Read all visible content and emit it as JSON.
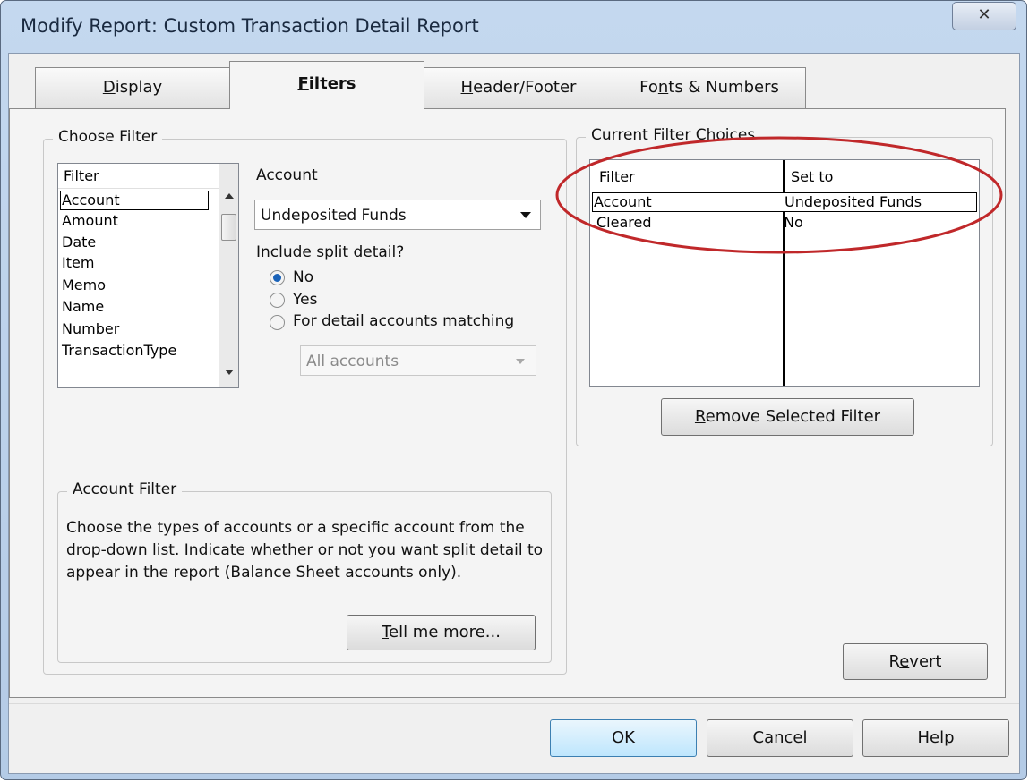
{
  "window": {
    "title": "Modify Report: Custom Transaction Detail Report",
    "close_glyph": "✕"
  },
  "tabs": [
    {
      "label": "Display",
      "key": "D",
      "rest": "isplay"
    },
    {
      "label": "Filters",
      "key": "F",
      "rest": "ilters"
    },
    {
      "label": "Header/Footer",
      "key": "H",
      "rest": "eader/Footer"
    },
    {
      "label": "Fonts & Numbers",
      "pre": "Fo",
      "key": "n",
      "rest": "ts & Numbers"
    }
  ],
  "choose_filter": {
    "group_label": "Choose Filter",
    "list_header": "Filter",
    "items": [
      "Account",
      "Amount",
      "Date",
      "Item",
      "Memo",
      "Name",
      "Number",
      "TransactionType"
    ],
    "selected": "Account"
  },
  "account": {
    "label": "Account",
    "value": "Undeposited Funds",
    "split_label": "Include split detail?",
    "options": [
      "No",
      "Yes",
      "For detail accounts matching"
    ],
    "selected_option": "No",
    "matching_value": "All accounts"
  },
  "account_filter": {
    "group_label": "Account Filter",
    "description": "Choose the types of accounts or a specific account from the drop-down list. Indicate whether or not you want split detail to appear in the report (Balance Sheet accounts only).",
    "tell_more": {
      "key": "T",
      "rest": "ell me more..."
    }
  },
  "current_filters": {
    "group_label": "Current Filter Choices",
    "col_filter": "Filter",
    "col_set_to": "Set to",
    "rows": [
      {
        "filter": "Account",
        "set_to": "Undeposited Funds"
      },
      {
        "filter": "Cleared",
        "set_to": "No"
      }
    ],
    "remove_button": {
      "key": "R",
      "rest": "emove Selected Filter"
    },
    "highlight_color": "#c0282a"
  },
  "buttons": {
    "revert": {
      "pre": "R",
      "key": "e",
      "rest": "vert"
    },
    "ok": "OK",
    "cancel": "Cancel",
    "help": "Help"
  }
}
